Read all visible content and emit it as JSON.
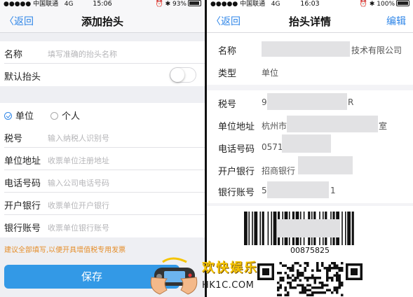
{
  "left": {
    "status": {
      "carrier": "●●●●● 中国联通",
      "network": "4G",
      "time": "15:06",
      "battery": "93%",
      "battery_level": 0.93
    },
    "nav": {
      "back": "返回",
      "title": "添加抬头"
    },
    "name_row": {
      "label": "名称",
      "placeholder": "填写准确的抬头名称"
    },
    "default_row": {
      "label": "默认抬头",
      "toggle_on": false
    },
    "type_options": [
      {
        "label": "单位",
        "checked": true
      },
      {
        "label": "个人",
        "checked": false
      }
    ],
    "fields": [
      {
        "label": "税号",
        "placeholder": "输入纳税人识别号"
      },
      {
        "label": "单位地址",
        "placeholder": "收票单位注册地址"
      },
      {
        "label": "电话号码",
        "placeholder": "输入公司电话号码"
      },
      {
        "label": "开户银行",
        "placeholder": "收票单位开户银行"
      },
      {
        "label": "银行账号",
        "placeholder": "收票单位银行账号"
      }
    ],
    "hint": "建议全部填写,以便开具增值税专用发票",
    "save": "保存"
  },
  "right": {
    "status": {
      "carrier": "●●●●● 中国联通",
      "network": "4G",
      "time": "16:03",
      "battery": "100%",
      "battery_level": 1.0
    },
    "nav": {
      "back": "返回",
      "title": "抬头详情",
      "edit": "编辑"
    },
    "rows": [
      {
        "label": "名称",
        "value": "技术有限公司"
      },
      {
        "label": "类型",
        "value": "单位"
      },
      {
        "label": "税号",
        "value": "9",
        "value_suffix": "R"
      },
      {
        "label": "单位地址",
        "value": "杭州市",
        "value_suffix": "室"
      },
      {
        "label": "电话号码",
        "value": "0571"
      },
      {
        "label": "开户银行",
        "value": "招商银行"
      },
      {
        "label": "银行账号",
        "value": "5",
        "value_suffix": "1"
      }
    ],
    "barcode_number": "00875825"
  },
  "watermark": {
    "title": "欢快娱乐",
    "url": "HK1C.COM"
  }
}
